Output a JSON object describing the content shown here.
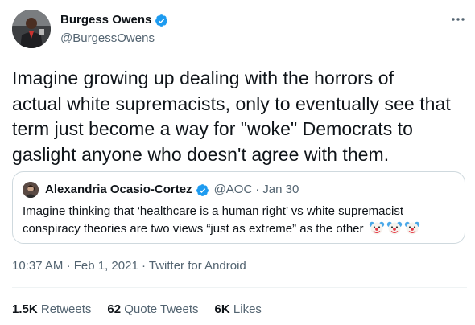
{
  "tweet": {
    "author": {
      "name": "Burgess Owens",
      "handle": "@BurgessOwens",
      "verified": true,
      "avatar": "profile-photo"
    },
    "text_lines": [
      "Imagine growing up dealing with the horrors of",
      "actual white supremacists, only to eventually see that",
      "term just become a way for \"woke\" Democrats to",
      "gaslight anyone who doesn't agree with them."
    ],
    "quoted": {
      "name": "Alexandria Ocasio-Cortez",
      "handle": "@AOC",
      "separator": "·",
      "date": "Jan 30",
      "verified": true,
      "text_line1": "Imagine thinking that ‘healthcare is a human right’ vs white supremacist",
      "text_line2": "conspiracy theories are two views “just as extreme” as the other",
      "emojis": [
        "clown-face-icon",
        "clown-face-icon",
        "clown-face-icon"
      ]
    },
    "time": "10:37 AM",
    "dot": "·",
    "date": "Feb 1, 2021",
    "source": "Twitter for Android",
    "stats": {
      "retweets_count": "1.5K",
      "retweets_label": "Retweets",
      "quotes_count": "62",
      "quotes_label": "Quote Tweets",
      "likes_count": "6K",
      "likes_label": "Likes"
    }
  },
  "colors": {
    "verified": "#1d9bf0",
    "secondary_text": "#536471",
    "primary_text": "#0f1419",
    "border": "#cfd9de"
  }
}
